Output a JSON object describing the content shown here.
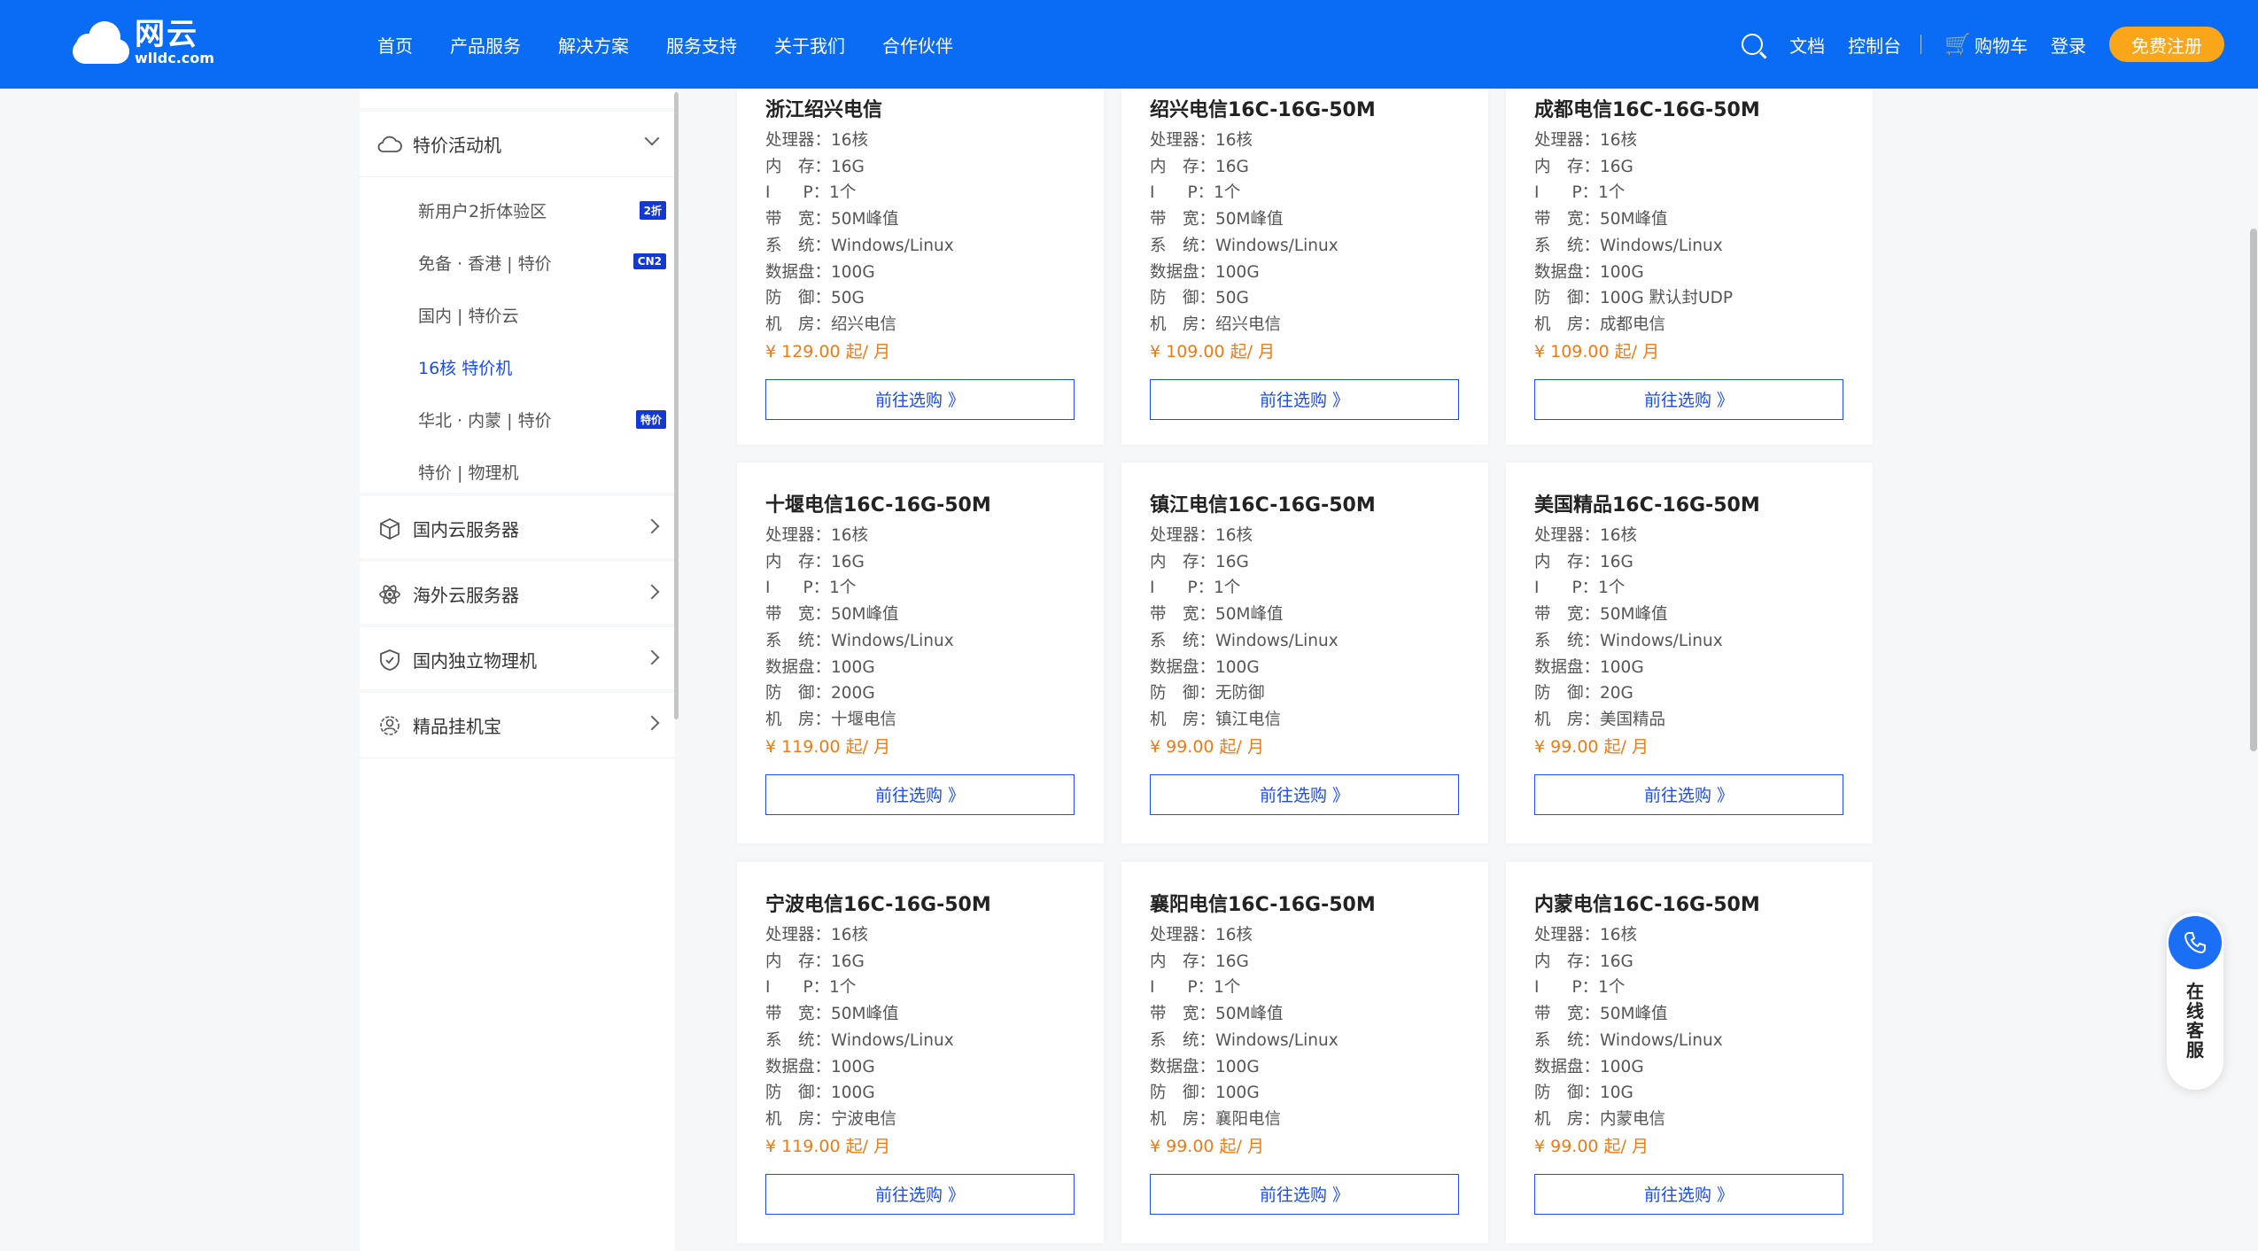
{
  "header": {
    "logo_main": "网云",
    "logo_sub": "wlldc.com",
    "nav": [
      "首页",
      "产品服务",
      "解决方案",
      "服务支持",
      "关于我们",
      "合作伙伴"
    ],
    "docs": "文档",
    "console": "控制台",
    "cart": "购物车",
    "login": "登录",
    "register": "免费注册"
  },
  "sidebar": {
    "groups": [
      {
        "label": "特价活动机",
        "icon": "cloud-icon",
        "expanded": true
      },
      {
        "label": "国内云服务器",
        "icon": "cube-icon"
      },
      {
        "label": "海外云服务器",
        "icon": "atom-icon"
      },
      {
        "label": "国内独立物理机",
        "icon": "shield-icon"
      },
      {
        "label": "精品挂机宝",
        "icon": "gear-user-icon"
      }
    ],
    "sub_items": [
      {
        "label": "新用户2折体验区",
        "badge": "2折"
      },
      {
        "label": "免备 · 香港 | 特价",
        "badge": "CN2"
      },
      {
        "label": "国内 | 特价云",
        "badge": ""
      },
      {
        "label": "16核 特价机",
        "badge": "",
        "active": true
      },
      {
        "label": "华北 · 内蒙 | 特价",
        "badge": "特价"
      },
      {
        "label": "特价 | 物理机",
        "badge": ""
      }
    ]
  },
  "spec_labels": {
    "cpu": "处理器：",
    "mem": "内　存：",
    "ip": "I　　P：",
    "bw": "带　宽：",
    "os": "系　统：",
    "disk": "数据盘：",
    "ddos": "防　御：",
    "room": "机　房："
  },
  "buy_label": "前往选购 》",
  "products": [
    {
      "title": "浙江绍兴电信",
      "cpu": "16核",
      "mem": "16G",
      "ip": "1个",
      "bw": "50M峰值",
      "os": "Windows/Linux",
      "disk": "100G",
      "ddos": "50G",
      "room": "绍兴电信",
      "price": "¥ 129.00 起/ 月"
    },
    {
      "title": "绍兴电信16C-16G-50M",
      "cpu": "16核",
      "mem": "16G",
      "ip": "1个",
      "bw": "50M峰值",
      "os": "Windows/Linux",
      "disk": "100G",
      "ddos": "50G",
      "room": "绍兴电信",
      "price": "¥ 109.00 起/ 月"
    },
    {
      "title": "成都电信16C-16G-50M",
      "cpu": "16核",
      "mem": "16G",
      "ip": "1个",
      "bw": "50M峰值",
      "os": "Windows/Linux",
      "disk": "100G",
      "ddos": "100G 默认封UDP",
      "room": "成都电信",
      "price": "¥ 109.00 起/ 月"
    },
    {
      "title": "十堰电信16C-16G-50M",
      "cpu": "16核",
      "mem": "16G",
      "ip": "1个",
      "bw": "50M峰值",
      "os": "Windows/Linux",
      "disk": "100G",
      "ddos": "200G",
      "room": "十堰电信",
      "price": "¥ 119.00 起/ 月"
    },
    {
      "title": "镇江电信16C-16G-50M",
      "cpu": "16核",
      "mem": "16G",
      "ip": "1个",
      "bw": "50M峰值",
      "os": "Windows/Linux",
      "disk": "100G",
      "ddos": "无防御",
      "room": "镇江电信",
      "price": "¥ 99.00 起/ 月"
    },
    {
      "title": "美国精品16C-16G-50M",
      "cpu": "16核",
      "mem": "16G",
      "ip": "1个",
      "bw": "50M峰值",
      "os": "Windows/Linux",
      "disk": "100G",
      "ddos": "20G",
      "room": "美国精品",
      "price": "¥ 99.00 起/ 月"
    },
    {
      "title": "宁波电信16C-16G-50M",
      "cpu": "16核",
      "mem": "16G",
      "ip": "1个",
      "bw": "50M峰值",
      "os": "Windows/Linux",
      "disk": "100G",
      "ddos": "100G",
      "room": "宁波电信",
      "price": "¥ 119.00 起/ 月"
    },
    {
      "title": "襄阳电信16C-16G-50M",
      "cpu": "16核",
      "mem": "16G",
      "ip": "1个",
      "bw": "50M峰值",
      "os": "Windows/Linux",
      "disk": "100G",
      "ddos": "100G",
      "room": "襄阳电信",
      "price": "¥ 99.00 起/ 月"
    },
    {
      "title": "内蒙电信16C-16G-50M",
      "cpu": "16核",
      "mem": "16G",
      "ip": "1个",
      "bw": "50M峰值",
      "os": "Windows/Linux",
      "disk": "100G",
      "ddos": "10G",
      "room": "内蒙电信",
      "price": "¥ 99.00 起/ 月"
    }
  ],
  "float": {
    "label_chars": [
      "在",
      "线",
      "客",
      "服"
    ],
    "icon": "phone-icon"
  },
  "colors": {
    "header_bg": "#0a6cf5",
    "accent": "#1a4cf0",
    "price": "#f07a14",
    "register": "#f9a61b"
  }
}
